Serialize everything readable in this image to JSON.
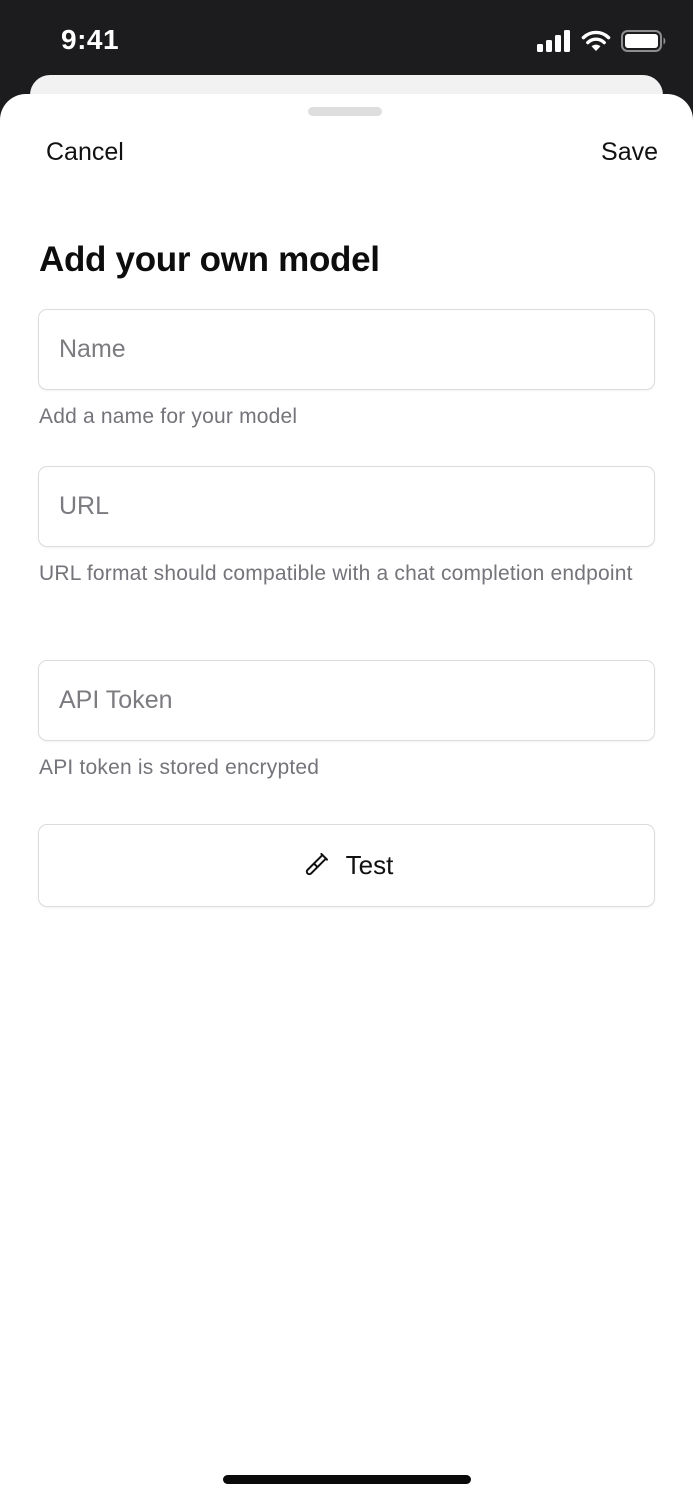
{
  "status_bar": {
    "time": "9:41",
    "icons": [
      "cellular-signal-icon",
      "wifi-icon",
      "battery-icon"
    ]
  },
  "nav": {
    "cancel_label": "Cancel",
    "save_label": "Save"
  },
  "title": "Add your own model",
  "fields": {
    "name": {
      "placeholder": "Name",
      "value": "",
      "helper": "Add a name for your model"
    },
    "url": {
      "placeholder": "URL",
      "value": "",
      "helper": "URL format should compatible with a chat completion endpoint"
    },
    "api_token": {
      "placeholder": "API Token",
      "value": "",
      "helper": "API token is stored encrypted"
    }
  },
  "test_button": {
    "label": "Test",
    "icon": "test-tube-icon"
  },
  "colors": {
    "screen_background": "#1c1c1e",
    "sheet_background": "#ffffff",
    "text_primary": "#111111",
    "text_secondary": "#74747a",
    "border": "#dcdcdc"
  }
}
